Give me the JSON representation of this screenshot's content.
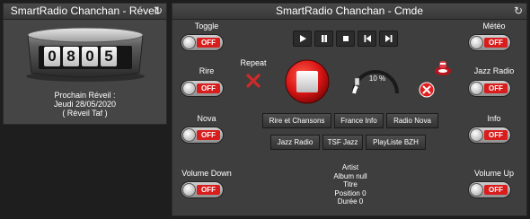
{
  "reveil": {
    "title": "SmartRadio Chanchan - Réveil",
    "clock": [
      "0",
      "8",
      "0",
      "5"
    ],
    "next_label": "Prochain Réveil :",
    "next_date": "Jeudi 28/05/2020",
    "next_name": "( Réveil Taf )"
  },
  "cmde": {
    "title": "SmartRadio Chanchan - Cmde",
    "toggles": {
      "toggle": {
        "label": "Toggle",
        "state": "OFF"
      },
      "rire": {
        "label": "Rire",
        "state": "OFF"
      },
      "nova": {
        "label": "Nova",
        "state": "OFF"
      },
      "volume_down": {
        "label": "Volume Down",
        "state": "OFF"
      },
      "meteo": {
        "label": "Météo",
        "state": "OFF"
      },
      "jazz_radio": {
        "label": "Jazz Radio",
        "state": "OFF"
      },
      "info": {
        "label": "Info",
        "state": "OFF"
      },
      "volume_up": {
        "label": "Volume Up",
        "state": "OFF"
      }
    },
    "repeat_label": "Repeat",
    "volume_text": "10 %",
    "volume_level": 0.1,
    "radios": [
      "Rire et Chansons",
      "France Info",
      "Radio Nova",
      "Jazz Radio",
      "TSF Jazz",
      "PlayListe BZH"
    ],
    "track": {
      "artist": "Artist",
      "album": "Album null",
      "title": "Titre",
      "position": "Position 0",
      "duration": "Durée 0"
    }
  },
  "colors": {
    "off_red": "#d91d1d",
    "accent_red": "#e02020"
  }
}
